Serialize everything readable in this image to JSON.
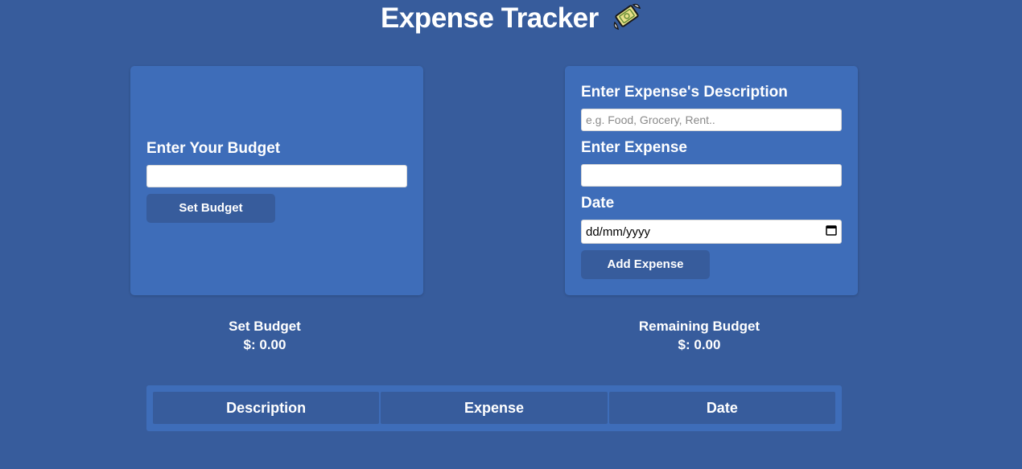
{
  "header": {
    "title": "Expense Tracker",
    "icon": "money-with-wings-icon"
  },
  "budget_form": {
    "label": "Enter Your Budget",
    "value": "",
    "button_label": "Set Budget"
  },
  "expense_form": {
    "description_label": "Enter Expense's Description",
    "description_placeholder": "e.g. Food, Grocery, Rent..",
    "description_value": "",
    "expense_label": "Enter Expense",
    "expense_value": "",
    "date_label": "Date",
    "date_placeholder": "dd/mm/yyyy",
    "button_label": "Add Expense"
  },
  "summary": {
    "set_budget_label": "Set Budget",
    "set_budget_value": "$: 0.00",
    "remaining_label": "Remaining Budget",
    "remaining_value": "$: 0.00"
  },
  "table": {
    "headers": [
      "Description",
      "Expense",
      "Date"
    ],
    "rows": []
  },
  "colors": {
    "background": "#375c9c",
    "card": "#3e6db9",
    "button": "#375c9c",
    "text": "#ffffff"
  }
}
